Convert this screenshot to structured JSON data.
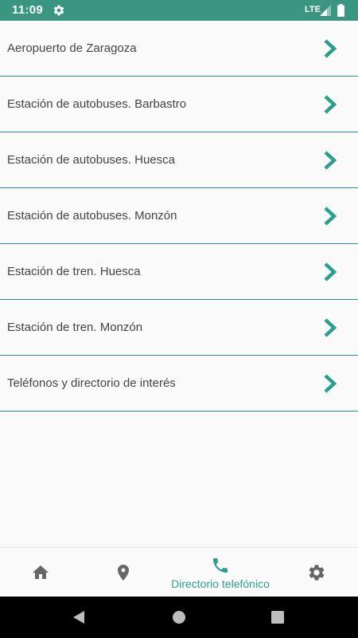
{
  "status_bar": {
    "time": "11:09",
    "network": "LTE",
    "icons": [
      "settings-gear-icon",
      "signal-icon",
      "battery-icon"
    ],
    "background_color": "#3a9680"
  },
  "list": {
    "divider_color": "#2e8aa3",
    "chevron_color": "#2aa08a",
    "items": [
      {
        "label": "Aeropuerto de Zaragoza"
      },
      {
        "label": "Estación de autobuses. Barbastro"
      },
      {
        "label": "Estación de autobuses. Huesca"
      },
      {
        "label": "Estación de autobuses. Monzón"
      },
      {
        "label": "Estación de tren. Huesca"
      },
      {
        "label": "Estación de tren. Monzón"
      },
      {
        "label": "Teléfonos y directorio de interés"
      }
    ]
  },
  "bottom_nav": {
    "active_color": "#2aa08a",
    "inactive_color": "#666666",
    "items": [
      {
        "icon": "home-icon",
        "label": "",
        "active": false
      },
      {
        "icon": "map-pin-icon",
        "label": "",
        "active": false
      },
      {
        "icon": "phone-icon",
        "label": "Directorio telefónico",
        "active": true
      },
      {
        "icon": "settings-icon",
        "label": "",
        "active": false
      }
    ]
  },
  "system_nav": {
    "buttons": [
      "back-icon",
      "home-circle-icon",
      "recents-icon"
    ]
  }
}
